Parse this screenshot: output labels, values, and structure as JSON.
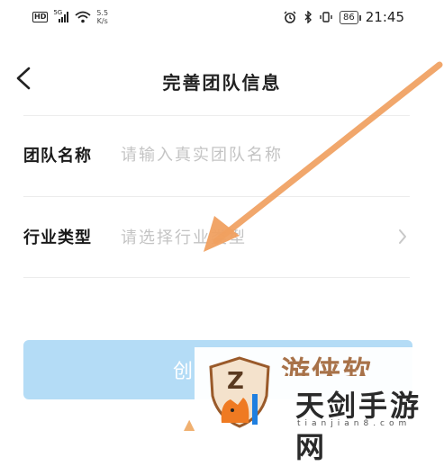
{
  "status_bar": {
    "hd_badge": "HD",
    "signal_type": "5G",
    "net_speed_value": "5.5",
    "net_speed_unit": "K/s",
    "battery_level": "86",
    "time": "21:45"
  },
  "header": {
    "title": "完善团队信息",
    "back_icon": "chevron-left-icon"
  },
  "form": {
    "team_name": {
      "label": "团队名称",
      "placeholder": "请输入真实团队名称",
      "value": ""
    },
    "industry_type": {
      "label": "行业类型",
      "placeholder": "请选择行业类型",
      "chevron_icon": "chevron-right-icon"
    }
  },
  "actions": {
    "create_label": "创"
  },
  "watermark": {
    "top_text": "游侠软",
    "main_text": "天剑手游网",
    "sub_text": "tianjian8.com",
    "shield_letter": "Z"
  },
  "colors": {
    "button_bg": "#b4dcf6",
    "arrow": "#f0a060",
    "placeholder": "#c4c4c4"
  }
}
